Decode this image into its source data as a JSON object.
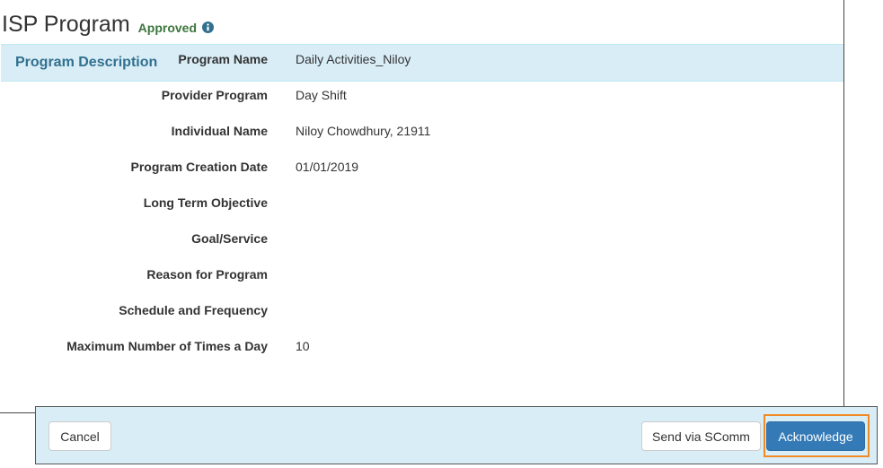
{
  "header": {
    "title": "ISP Program",
    "status": "Approved",
    "status_icon": "info-circle-icon",
    "status_color": "#3c763d"
  },
  "panel": {
    "title": "Program Description",
    "heading_bg": "#d9edf7",
    "heading_color": "#31708f",
    "fields": [
      {
        "label": "Program Name",
        "value": "Daily Activities_Niloy"
      },
      {
        "label": "Provider Program",
        "value": "Day Shift"
      },
      {
        "label": "Individual Name",
        "value": "Niloy Chowdhury, 21911"
      },
      {
        "label": "Program Creation Date",
        "value": "01/01/2019"
      },
      {
        "label": "Long Term Objective",
        "value": ""
      },
      {
        "label": "Goal/Service",
        "value": ""
      },
      {
        "label": "Reason for Program",
        "value": ""
      },
      {
        "label": "Schedule and Frequency",
        "value": ""
      },
      {
        "label": "Maximum Number of Times a Day",
        "value": "10"
      }
    ]
  },
  "footer": {
    "cancel_label": "Cancel",
    "send_label": "Send via SComm",
    "acknowledge_label": "Acknowledge",
    "primary_color": "#337ab7",
    "highlight_color": "#f08a24"
  }
}
